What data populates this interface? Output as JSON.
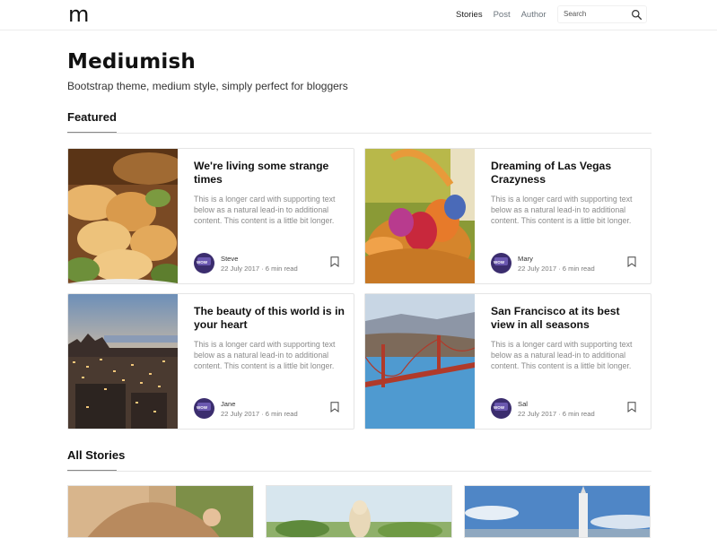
{
  "nav": {
    "brand": "m",
    "links": [
      {
        "label": "Stories",
        "active": true
      },
      {
        "label": "Post",
        "active": false
      },
      {
        "label": "Author",
        "active": false
      }
    ],
    "search_placeholder": "Search"
  },
  "header": {
    "title": "Mediumish",
    "tagline": "Bootstrap theme, medium style, simply perfect for bloggers"
  },
  "featured": {
    "section_title": "Featured",
    "cards": [
      {
        "title": "We're living some strange times",
        "text": "This is a longer card with supporting text below as a natural lead-in to additional content. This content is a little bit longer.",
        "author": "Steve",
        "meta": "22 July 2017 · 6 min read",
        "image": "food"
      },
      {
        "title": "Dreaming of Las Vegas Crazyness",
        "text": "This is a longer card with supporting text below as a natural lead-in to additional content. This content is a little bit longer.",
        "author": "Mary",
        "meta": "22 July 2017 · 6 min read",
        "image": "easter-basket"
      },
      {
        "title": "The beauty of this world is in your heart",
        "text": "This is a longer card with supporting text below as a natural lead-in to additional content. This content is a little bit longer.",
        "author": "Jane",
        "meta": "22 July 2017 · 6 min read",
        "image": "city-sunset"
      },
      {
        "title": "San Francisco at its best view in all seasons",
        "text": "This is a longer card with supporting text below as a natural lead-in to additional content. This content is a little bit longer.",
        "author": "Sal",
        "meta": "22 July 2017 · 6 min read",
        "image": "golden-gate"
      }
    ],
    "avatar_text": "WOW"
  },
  "all_stories": {
    "section_title": "All Stories"
  },
  "colors": {
    "text": "#111111",
    "muted": "#8a8a8a",
    "border": "#e5e5e5",
    "avatar": "#3b2d6e"
  }
}
